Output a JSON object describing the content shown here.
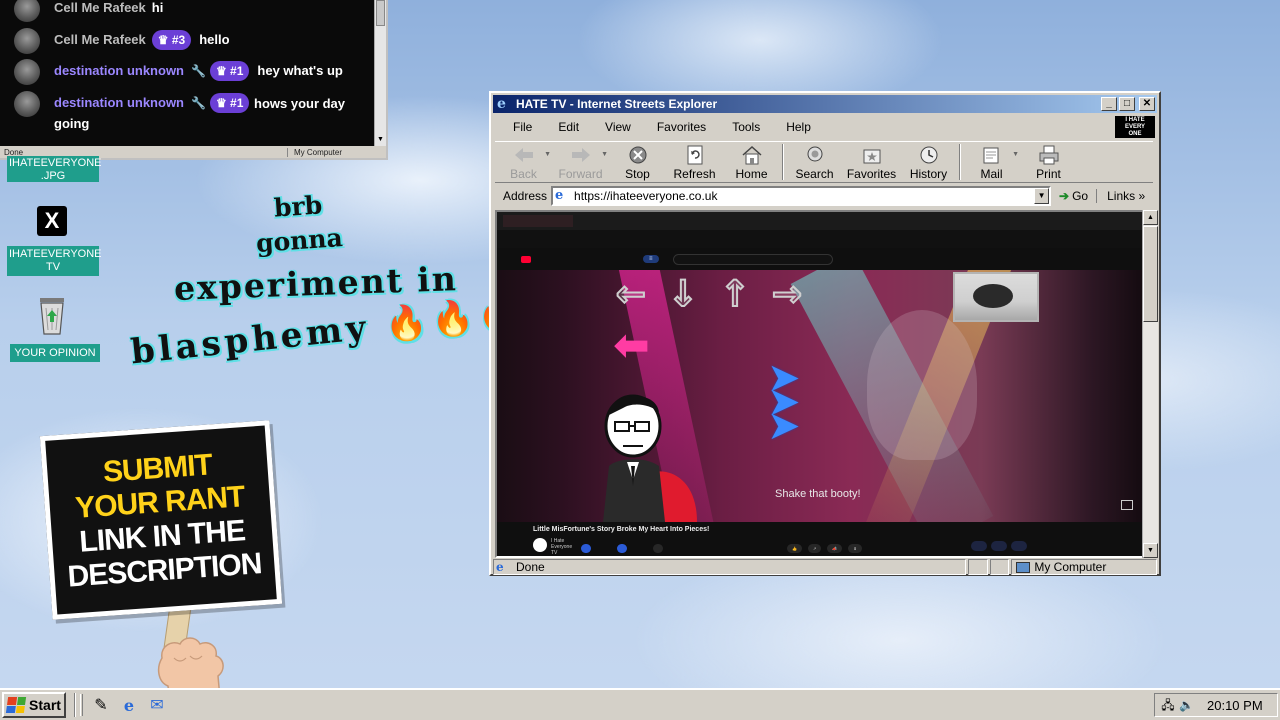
{
  "chat": {
    "messages": [
      {
        "user": "Cell Me Rafeek",
        "badge": "",
        "text": "hi"
      },
      {
        "user": "Cell Me Rafeek",
        "badge": "#3",
        "text": "hello"
      },
      {
        "user": "destination unknown",
        "badge": "#1",
        "text": "hey what's up"
      },
      {
        "user": "destination unknown",
        "badge": "#1",
        "text": "hows your day going"
      }
    ],
    "status_left": "Done",
    "status_right": "My Computer"
  },
  "desktop": {
    "icons": [
      {
        "label": "IHATEEVERYONE .JPG",
        "icon": "image-file-icon"
      },
      {
        "label": "IHATEEVERYONE TV",
        "icon": "x-logo-icon",
        "glyph": "X"
      },
      {
        "label": "YOUR OPINION",
        "icon": "recycle-bin-icon"
      }
    ]
  },
  "overlay": {
    "line1": "brb",
    "line2": "gonna",
    "line3": "experiment in",
    "line4": "blasphemy 🔥🔥🔥"
  },
  "sign": {
    "line1": "SUBMIT",
    "line2": "YOUR RANT",
    "line3": "LINK IN THE",
    "line4": "DESCRIPTION"
  },
  "ie": {
    "title": "HATE TV - Internet Streets Explorer",
    "menu": [
      "File",
      "Edit",
      "View",
      "Favorites",
      "Tools",
      "Help"
    ],
    "toolbar": [
      {
        "label": "Back",
        "icon": "back-arrow-icon",
        "enabled": false
      },
      {
        "label": "Forward",
        "icon": "forward-arrow-icon",
        "enabled": false
      },
      {
        "label": "Stop",
        "icon": "stop-icon",
        "enabled": true
      },
      {
        "label": "Refresh",
        "icon": "refresh-icon",
        "enabled": true
      },
      {
        "label": "Home",
        "icon": "home-icon",
        "enabled": true
      },
      {
        "label": "Search",
        "icon": "search-icon",
        "enabled": true
      },
      {
        "label": "Favorites",
        "icon": "favorites-icon",
        "enabled": true
      },
      {
        "label": "History",
        "icon": "history-icon",
        "enabled": true
      },
      {
        "label": "Mail",
        "icon": "mail-icon",
        "enabled": true
      },
      {
        "label": "Print",
        "icon": "print-icon",
        "enabled": true
      }
    ],
    "address_label": "Address",
    "address": "https://ihateeveryone.co.uk",
    "go_label": "Go",
    "links_label": "Links",
    "status_text": "Done",
    "zone": "My Computer"
  },
  "video": {
    "caption": "Shake that booty!",
    "title": "Little MisFortune's Story Broke My Heart Into Pieces!",
    "channel": "I Hate Everyone TV"
  },
  "taskbar": {
    "start_label": "Start",
    "clock": "20:10 PM"
  },
  "colors": {
    "chat_purple": "#9b87ff",
    "badge_purple": "#6b3fd6",
    "desktop_label_teal": "#1f9e8c",
    "sign_yellow": "#ffd21a",
    "sign_red": "#ff2a2a",
    "titlebar_blue": "#0a246a"
  }
}
